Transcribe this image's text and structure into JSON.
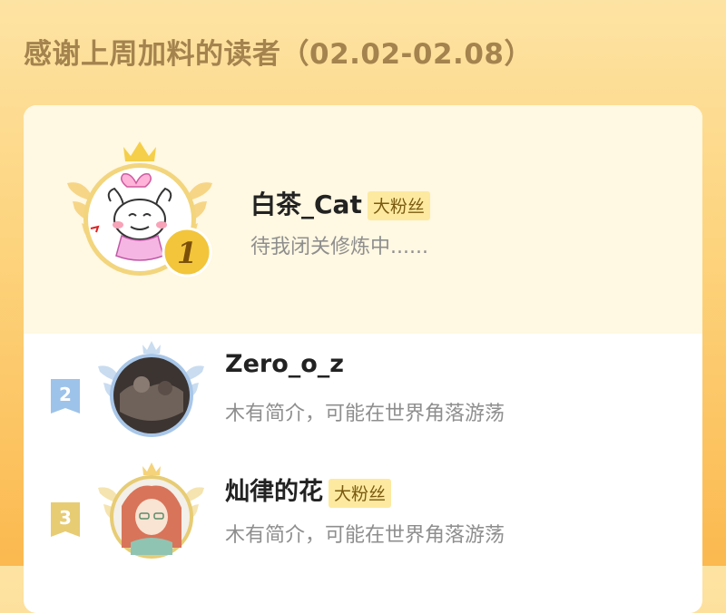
{
  "header": {
    "title": "感谢上周加料的读者（02.02-02.08）"
  },
  "leaderboard": {
    "top": {
      "rank": "1",
      "name": "白茶_Cat",
      "badge": "大粉丝",
      "bio": "待我闭关修炼中......"
    },
    "rows": [
      {
        "rank": "2",
        "name": "Zero_o_z",
        "badge": "",
        "bio": "木有简介，可能在世界角落游荡"
      },
      {
        "rank": "3",
        "name": "灿律的花",
        "badge": "大粉丝",
        "bio": "木有简介，可能在世界角落游荡"
      }
    ]
  },
  "colors": {
    "gold": "#f2c53a",
    "silver_flag": "#9dc3ea",
    "bronze_flag": "#e7cc74",
    "title": "#a4834e",
    "badge_bg": "#fdeaa0"
  }
}
